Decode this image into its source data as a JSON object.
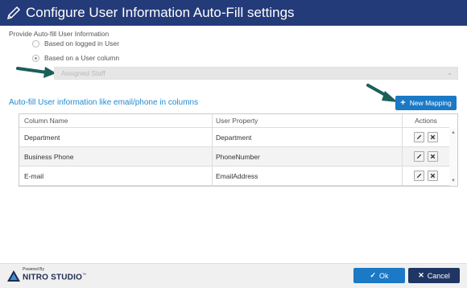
{
  "dialog": {
    "title": "Configure User Information Auto-Fill settings",
    "header_color": "#243b7a"
  },
  "provide": {
    "label": "Provide Auto-fill User Information",
    "options": [
      {
        "label": "Based on logged in User",
        "checked": false
      },
      {
        "label": "Based on a User column",
        "checked": true
      }
    ],
    "user_column": {
      "value": "Assigned Staff",
      "disabled": true
    }
  },
  "mappings": {
    "title": "Auto-fill User information like email/phone in columns",
    "new_button": {
      "icon": "plus-icon",
      "label": "New Mapping"
    },
    "columns": [
      "Column Name",
      "User Property",
      "Actions"
    ],
    "rows": [
      {
        "column_name": "Department",
        "user_property": "Department"
      },
      {
        "column_name": "Business Phone",
        "user_property": "PhoneNumber"
      },
      {
        "column_name": "E-mail",
        "user_property": "EmailAddress"
      }
    ],
    "row_actions": [
      "edit-icon",
      "delete-icon"
    ]
  },
  "footer": {
    "powered_by": "Powered By",
    "brand": "NITRO STUDIO",
    "trademark": "™",
    "ok": {
      "icon": "check-icon",
      "label": "Ok"
    },
    "cancel": {
      "icon": "close-icon",
      "label": "Cancel"
    }
  },
  "colors": {
    "accent": "#1b79c6",
    "cancel": "#1f3563",
    "arrow": "#1d5e5a",
    "link_title": "#1f8ad1"
  }
}
